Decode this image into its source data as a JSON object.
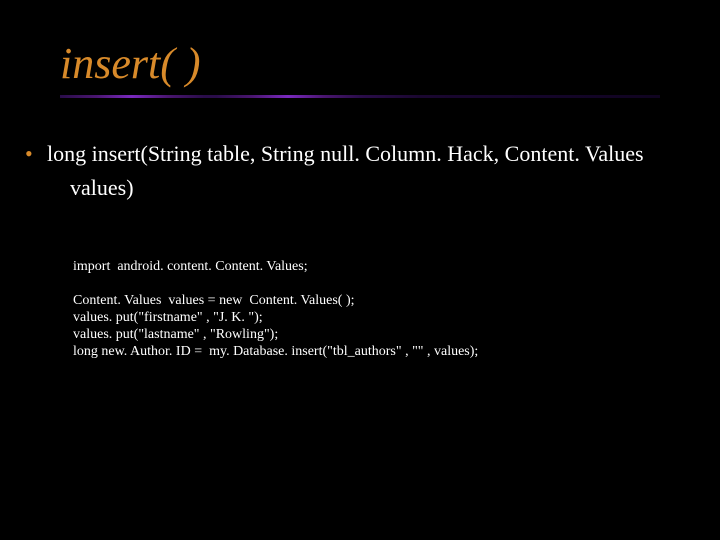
{
  "title": "insert( )",
  "signature_line1": "long  insert(String table, String null. Column. Hack, Content. Values",
  "signature_line2": "values)",
  "code": {
    "l1": "import  android. content. Content. Values;",
    "l2": "Content. Values  values = new  Content. Values( );",
    "l3": "values. put(\"firstname\" , \"J. K. \");",
    "l4": "values. put(\"lastname\" , \"Rowling\");",
    "l5": "long new. Author. ID =  my. Database. insert(\"tbl_authors\" , \"\" , values);"
  }
}
